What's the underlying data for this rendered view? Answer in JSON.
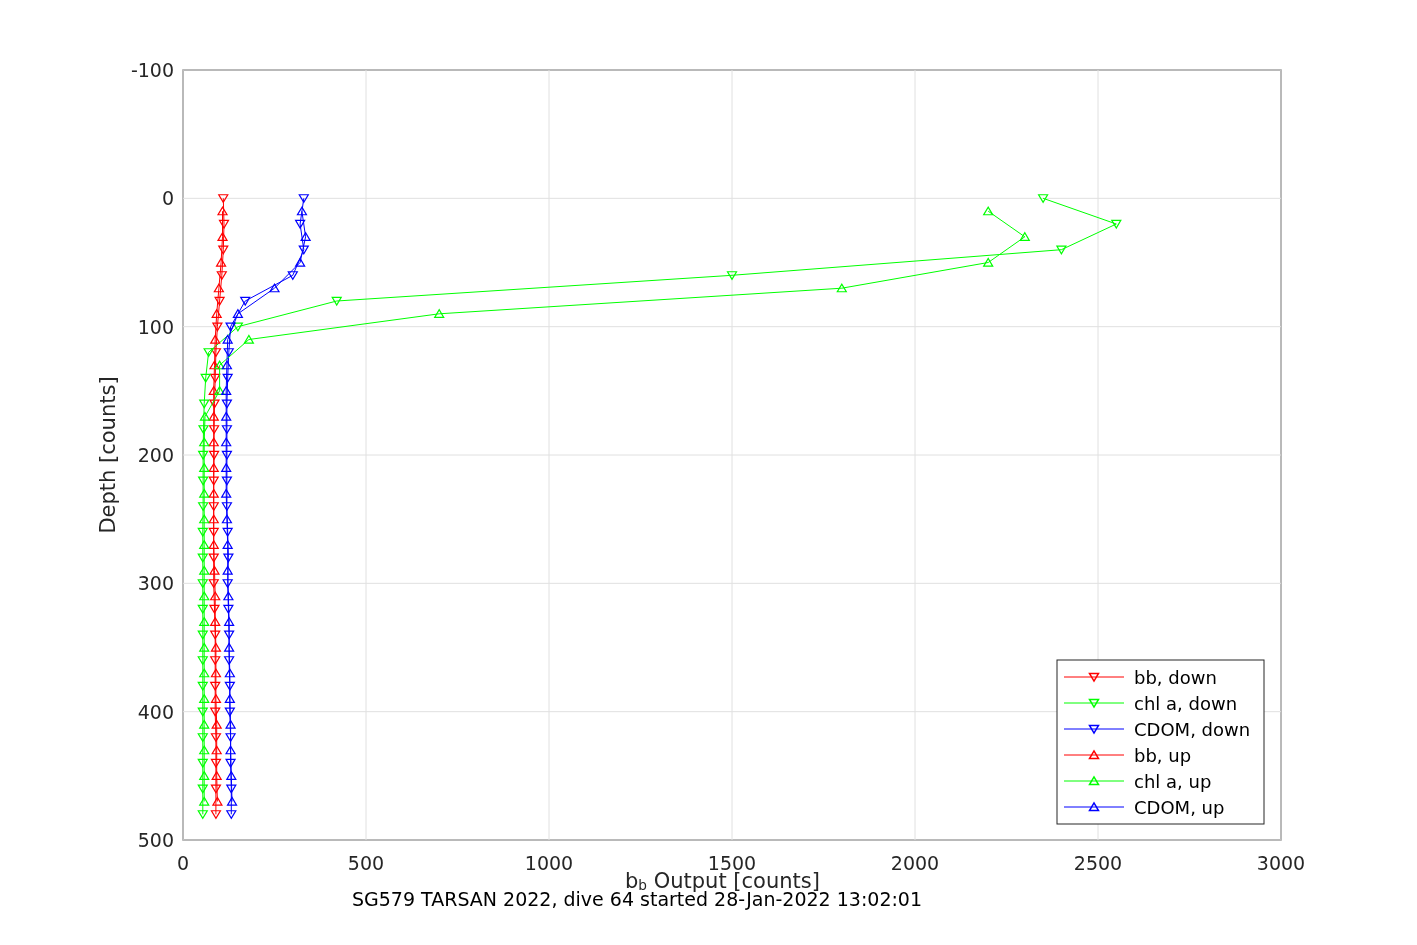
{
  "figure": {
    "chart_data": {
      "type": "line",
      "orientation": "horizontal",
      "title": "SG579 TARSAN 2022, dive 64 started 28-Jan-2022 13:02:01",
      "xlabel": "b$_{b}$ Output [counts]",
      "ylabel": "Depth [counts]",
      "x": [
        0,
        10,
        20,
        30,
        40,
        50,
        60,
        70,
        80,
        90,
        100,
        110,
        120,
        130,
        140,
        150,
        160,
        170,
        180,
        190,
        200,
        210,
        220,
        230,
        240,
        250,
        260,
        270,
        280,
        290,
        300,
        310,
        320,
        330,
        340,
        350,
        360,
        370,
        380,
        390,
        400,
        410,
        420,
        430,
        440,
        450,
        460,
        470,
        480
      ],
      "series": [
        {
          "name": "bb, down",
          "color": "#ff0000",
          "marker": "triangle",
          "values": [
            110,
            null,
            112,
            null,
            110,
            null,
            106,
            null,
            100,
            null,
            94,
            null,
            90,
            null,
            88,
            null,
            86,
            null,
            85,
            null,
            85,
            null,
            84,
            null,
            84,
            null,
            84,
            null,
            84,
            null,
            84,
            null,
            86,
            null,
            88,
            null,
            88,
            null,
            88,
            null,
            88,
            null,
            90,
            null,
            90,
            null,
            90,
            null,
            90
          ]
        },
        {
          "name": "chl a, down",
          "color": "#00ff00",
          "marker": "triangle",
          "values": [
            2350,
            null,
            2550,
            null,
            2400,
            null,
            1500,
            null,
            420,
            null,
            150,
            null,
            70,
            null,
            62,
            null,
            58,
            null,
            56,
            null,
            55,
            null,
            55,
            null,
            55,
            null,
            54,
            null,
            54,
            null,
            54,
            null,
            54,
            null,
            54,
            null,
            54,
            null,
            54,
            null,
            54,
            null,
            54,
            null,
            54,
            null,
            54,
            null,
            54
          ]
        },
        {
          "name": "CDOM, down",
          "color": "#0000ff",
          "marker": "triangle",
          "values": [
            330,
            null,
            320,
            null,
            330,
            null,
            300,
            null,
            170,
            null,
            130,
            null,
            125,
            null,
            122,
            null,
            120,
            null,
            120,
            null,
            120,
            null,
            120,
            null,
            120,
            null,
            122,
            null,
            124,
            null,
            122,
            null,
            124,
            null,
            126,
            null,
            126,
            null,
            128,
            null,
            128,
            null,
            130,
            null,
            130,
            null,
            132,
            null,
            132
          ]
        },
        {
          "name": "bb, up",
          "color": "#ff0000",
          "marker": "triangle",
          "values": [
            null,
            108,
            null,
            108,
            null,
            104,
            null,
            98,
            null,
            92,
            null,
            88,
            null,
            86,
            null,
            84,
            null,
            84,
            null,
            84,
            null,
            84,
            null,
            84,
            null,
            84,
            null,
            84,
            null,
            86,
            null,
            88,
            null,
            88,
            null,
            90,
            null,
            90,
            null,
            90,
            null,
            92,
            null,
            92,
            null,
            92,
            null,
            94,
            null
          ]
        },
        {
          "name": "chl a, up",
          "color": "#00ff00",
          "marker": "triangle",
          "values": [
            null,
            2200,
            null,
            2300,
            null,
            2200,
            null,
            1800,
            null,
            700,
            null,
            180,
            null,
            100,
            null,
            100,
            null,
            60,
            null,
            58,
            null,
            58,
            null,
            58,
            null,
            58,
            null,
            58,
            null,
            58,
            null,
            58,
            null,
            58,
            null,
            58,
            null,
            58,
            null,
            58,
            null,
            58,
            null,
            58,
            null,
            58,
            null,
            58,
            null
          ]
        },
        {
          "name": "CDOM, up",
          "color": "#0000ff",
          "marker": "triangle",
          "values": [
            null,
            325,
            null,
            335,
            null,
            320,
            null,
            250,
            null,
            150,
            null,
            122,
            null,
            120,
            null,
            118,
            null,
            118,
            null,
            118,
            null,
            118,
            null,
            118,
            null,
            120,
            null,
            122,
            null,
            122,
            null,
            124,
            null,
            126,
            null,
            126,
            null,
            128,
            null,
            128,
            null,
            130,
            null,
            130,
            null,
            132,
            null,
            134,
            null
          ]
        }
      ],
      "grid": true,
      "legend": true,
      "xlim": [
        0,
        3000
      ],
      "ylim": [
        500,
        -100
      ],
      "xticks": [
        0,
        500,
        1000,
        1500,
        2000,
        2500,
        3000
      ],
      "yticks": [
        -100,
        0,
        100,
        200,
        300,
        400,
        500
      ]
    }
  }
}
